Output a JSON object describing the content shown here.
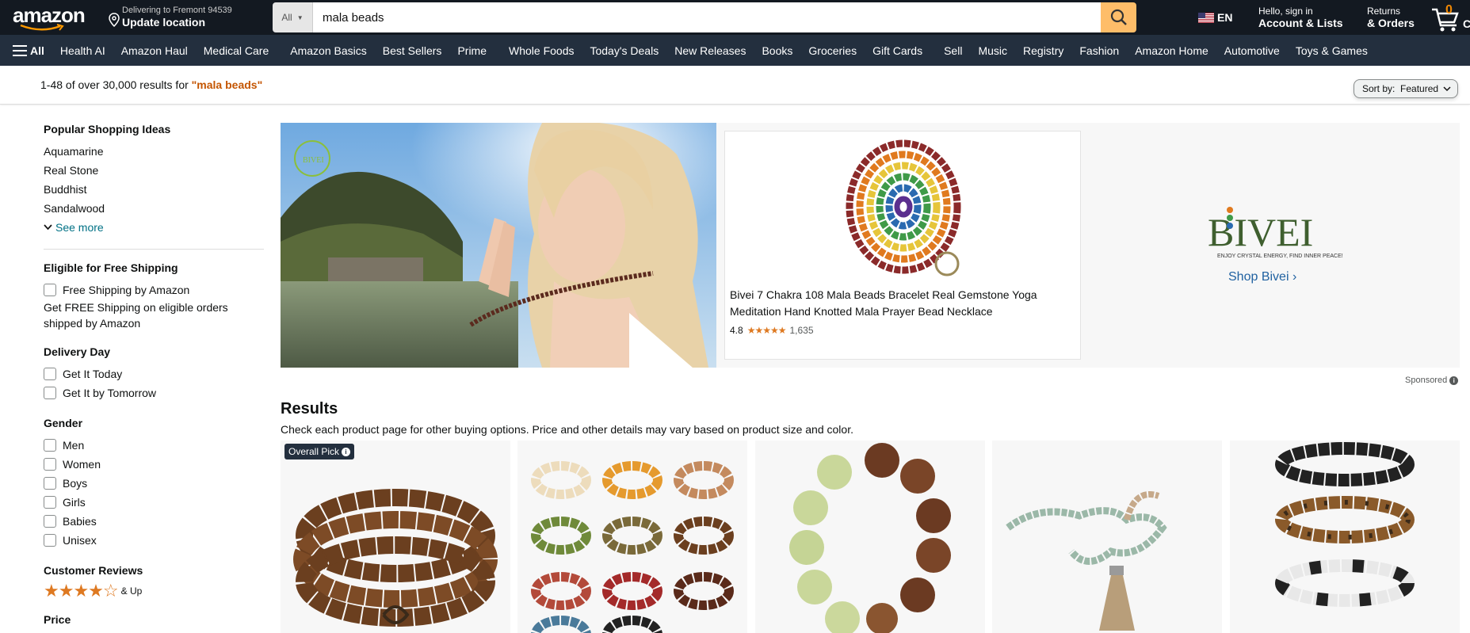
{
  "header": {
    "logo_text": "amazon",
    "deliver_line1": "Delivering to Fremont 94539",
    "deliver_line2": "Update location",
    "search_category": "All",
    "search_query": "mala beads",
    "language": "EN",
    "account_line1": "Hello, sign in",
    "account_line2": "Account & Lists",
    "returns_line1": "Returns",
    "returns_line2": "& Orders",
    "cart_count": "0",
    "cart_label": "C"
  },
  "nav": {
    "all_label": "All",
    "items": [
      "Health AI",
      "Amazon Haul",
      "Medical Care",
      "Amazon Basics",
      "Best Sellers",
      "Prime",
      "Whole Foods",
      "Today's Deals",
      "New Releases",
      "Books",
      "Groceries",
      "Gift Cards",
      "Sell",
      "Music",
      "Registry",
      "Fashion",
      "Amazon Home",
      "Automotive",
      "Toys & Games"
    ]
  },
  "results_bar": {
    "count_text": "1-48 of over 30,000 results for ",
    "query_text": "\"mala beads\"",
    "sort_label": "Sort by:",
    "sort_value": "Featured"
  },
  "sidebar": {
    "popular_title": "Popular Shopping Ideas",
    "popular": [
      "Aquamarine",
      "Real Stone",
      "Buddhist",
      "Sandalwood"
    ],
    "see_more": "See more",
    "shipping_title": "Eligible for Free Shipping",
    "shipping_option": "Free Shipping by Amazon",
    "shipping_text": "Get FREE Shipping on eligible orders shipped by Amazon",
    "delivery_title": "Delivery Day",
    "delivery": [
      "Get It Today",
      "Get It by Tomorrow"
    ],
    "gender_title": "Gender",
    "gender": [
      "Men",
      "Women",
      "Boys",
      "Girls",
      "Babies",
      "Unisex"
    ],
    "reviews_title": "Customer Reviews",
    "reviews_stars": "★★★★☆",
    "reviews_suffix": "& Up",
    "price_title": "Price"
  },
  "banner": {
    "watermark_text": "BIVEI",
    "product_title": "Bivei 7 Chakra 108 Mala Beads Bracelet Real Gemstone Yoga Meditation Hand Knotted Mala Prayer Bead Necklace",
    "rating": "4.8",
    "stars": "★★★★★",
    "rating_count": "1,635",
    "brand_name": "BIVEI",
    "brand_tagline": "ENJOY CRYSTAL ENERGY, FIND INNER PEACE!",
    "shop_link": "Shop Bivei ›",
    "sponsored": "Sponsored"
  },
  "results": {
    "title": "Results",
    "subtitle": "Check each product page for other buying options. Price and other details may vary based on product size and color.",
    "badge": "Overall Pick"
  },
  "colors": {
    "nav_dark": "#131921",
    "nav_secondary": "#232f3e",
    "search_button": "#febd69",
    "link": "#007185",
    "query": "#c45500",
    "star": "#de7921"
  }
}
